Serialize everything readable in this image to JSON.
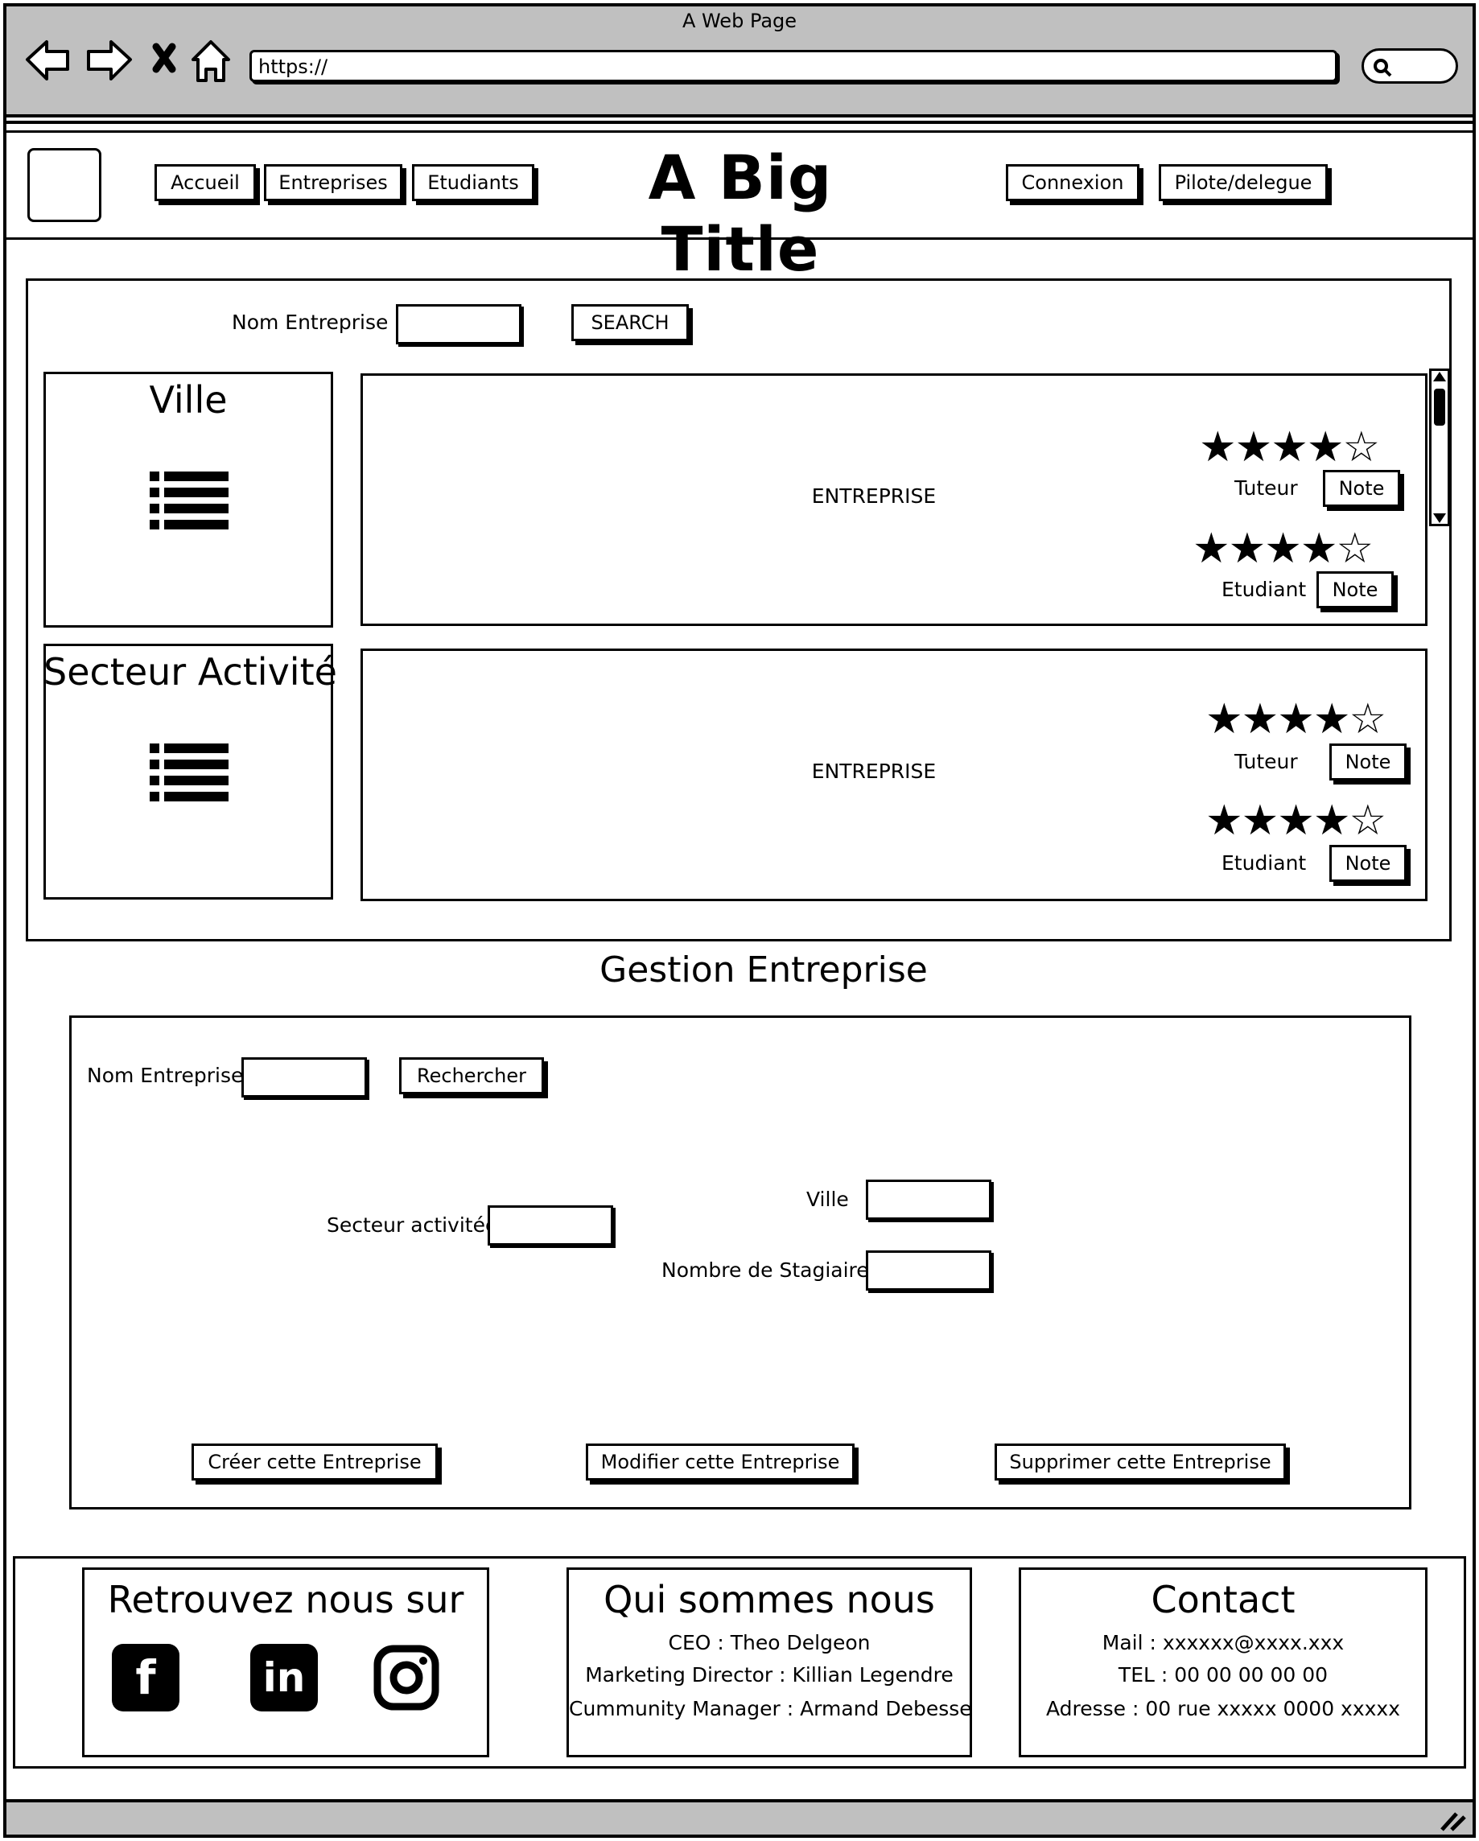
{
  "browser": {
    "window_title": "A Web Page",
    "url": "https://"
  },
  "nav": {
    "left_items": [
      "Accueil",
      "Entreprises",
      "Etudiants"
    ],
    "title": "A Big Title",
    "right_items": [
      "Connexion",
      "Pilote/delegue"
    ]
  },
  "search": {
    "label": "Nom Entreprise",
    "button": "SEARCH"
  },
  "filters": {
    "ville": "Ville",
    "secteur": "Secteur Activité"
  },
  "results": [
    {
      "name": "ENTREPRISE",
      "ratings": [
        {
          "label": "Tuteur",
          "stars": 4,
          "max": 5,
          "button": "Note"
        },
        {
          "label": "Etudiant",
          "stars": 4,
          "max": 5,
          "button": "Note"
        }
      ]
    },
    {
      "name": "ENTREPRISE",
      "ratings": [
        {
          "label": "Tuteur",
          "stars": 4,
          "max": 5,
          "button": "Note"
        },
        {
          "label": "Etudiant",
          "stars": 4,
          "max": 5,
          "button": "Note"
        }
      ]
    }
  ],
  "gestion": {
    "title": "Gestion Entreprise",
    "search_label": "Nom Entreprise",
    "search_button": "Rechercher",
    "secteur_label": "Secteur activitée",
    "ville_label": "Ville",
    "stagiaire_label": "Nombre de Stagiaire",
    "create_button": "Créer cette Entreprise",
    "modify_button": "Modifier cette Entreprise",
    "delete_button": "Supprimer cette Entreprise"
  },
  "footer": {
    "social_title": "Retrouvez nous sur",
    "social_icons": [
      "facebook-icon",
      "linkedin-icon",
      "instagram-icon"
    ],
    "about_title": "Qui sommes nous",
    "about_lines": [
      "CEO : Theo Delgeon",
      "Marketing Director : Killian Legendre",
      "Cummunity Manager : Armand Debesse"
    ],
    "contact_title": "Contact",
    "contact_lines": [
      "Mail : xxxxxx@xxxx.xxx",
      "TEL : 00 00 00 00 00",
      "Adresse : 00 rue xxxxx 0000 xxxxx"
    ]
  }
}
